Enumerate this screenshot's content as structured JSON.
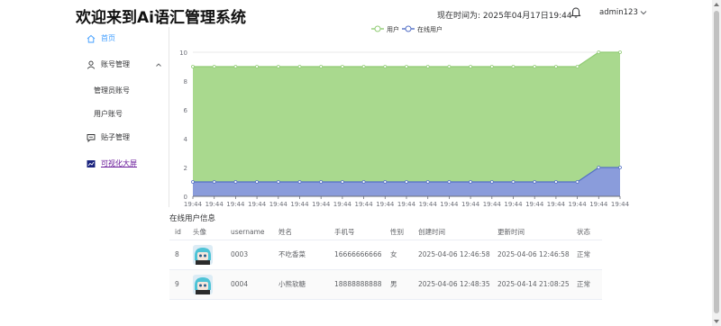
{
  "header": {
    "title": "欢迎来到Ai语汇管理系统",
    "time_text": "现在时间为: 2025年04月17日19:44",
    "username": "admin123"
  },
  "sidebar": {
    "items": [
      {
        "label": "首页",
        "icon": "home-icon"
      },
      {
        "label": "账号管理",
        "icon": "user-icon"
      },
      {
        "label": "管理员账号"
      },
      {
        "label": "用户账号"
      },
      {
        "label": "贴子管理",
        "icon": "message-icon"
      },
      {
        "label": "可视化大屏",
        "icon": "screen-icon"
      }
    ]
  },
  "colors": {
    "users_line": "#91cc75",
    "users_area": "#a9d98e",
    "online_line": "#5470c6",
    "online_area": "#8a9cdb",
    "active_nav": "#409eff"
  },
  "chart_data": {
    "type": "area",
    "series": [
      {
        "name": "用户",
        "values": [
          9,
          9,
          9,
          9,
          9,
          9,
          9,
          9,
          9,
          9,
          9,
          9,
          9,
          9,
          9,
          9,
          9,
          9,
          9,
          10,
          10
        ]
      },
      {
        "name": "在线用户",
        "values": [
          1,
          1,
          1,
          1,
          1,
          1,
          1,
          1,
          1,
          1,
          1,
          1,
          1,
          1,
          1,
          1,
          1,
          1,
          1,
          2,
          2
        ]
      }
    ],
    "categories": [
      "19:44",
      "19:44",
      "19:44",
      "19:44",
      "19:44",
      "19:44",
      "19:44",
      "19:44",
      "19:44",
      "19:44",
      "19:44",
      "19:44",
      "19:44",
      "19:44",
      "19:44",
      "19:44",
      "19:44",
      "19:44",
      "19:44",
      "19:44",
      "19:44"
    ],
    "ylim": [
      0,
      10
    ],
    "yticks": [
      "0",
      "2",
      "4",
      "6",
      "8",
      "10"
    ],
    "legend_position": "top-center",
    "stacked": false
  },
  "online_section": {
    "title": "在线用户信息",
    "columns": [
      "id",
      "头像",
      "username",
      "姓名",
      "手机号",
      "性别",
      "创建时间",
      "更新时间",
      "状态"
    ],
    "rows": [
      {
        "id": "8",
        "username": "0003",
        "name": "不吃香菜",
        "phone": "16666666666",
        "gender": "女",
        "created": "2025-04-06 12:46:58",
        "updated": "2025-04-06 12:46:58",
        "status": "正常"
      },
      {
        "id": "9",
        "username": "0004",
        "name": "小熊软糖",
        "phone": "18888888888",
        "gender": "男",
        "created": "2025-04-06 12:48:35",
        "updated": "2025-04-14 21:08:25",
        "status": "正常"
      }
    ]
  }
}
